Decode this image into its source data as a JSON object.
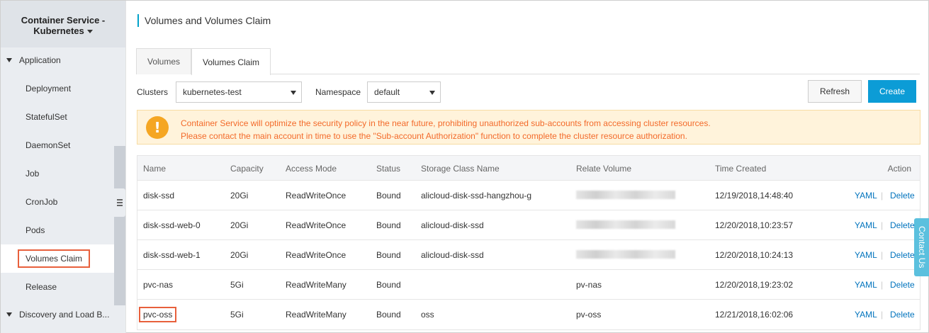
{
  "sidebar": {
    "header_line1": "Container Service -",
    "header_line2": "Kubernetes",
    "group_application": "Application",
    "items": [
      {
        "label": "Deployment"
      },
      {
        "label": "StatefulSet"
      },
      {
        "label": "DaemonSet"
      },
      {
        "label": "Job"
      },
      {
        "label": "CronJob"
      },
      {
        "label": "Pods"
      },
      {
        "label": "Volumes Claim"
      },
      {
        "label": "Release"
      }
    ],
    "group_discovery": "Discovery and Load B..."
  },
  "page_title": "Volumes and Volumes Claim",
  "tabs": [
    {
      "label": "Volumes"
    },
    {
      "label": "Volumes Claim"
    }
  ],
  "filters": {
    "clusters_label": "Clusters",
    "clusters_value": "kubernetes-test",
    "namespace_label": "Namespace",
    "namespace_value": "default"
  },
  "buttons": {
    "refresh": "Refresh",
    "create": "Create"
  },
  "alert": {
    "icon": "!",
    "line1": "Container Service will optimize the security policy in the near future, prohibiting unauthorized sub-accounts from accessing cluster resources.",
    "line2": "Please contact the main account in time to use the \"Sub-account Authorization\" function to complete the cluster resource authorization."
  },
  "table": {
    "headers": {
      "name": "Name",
      "capacity": "Capacity",
      "access_mode": "Access Mode",
      "status": "Status",
      "storage_class": "Storage Class Name",
      "relate_volume": "Relate Volume",
      "time_created": "Time Created",
      "action": "Action"
    },
    "rows": [
      {
        "name": "disk-ssd",
        "capacity": "20Gi",
        "access_mode": "ReadWriteOnce",
        "status": "Bound",
        "storage_class": "alicloud-disk-ssd-hangzhou-g",
        "relate_volume": "",
        "time_created": "12/19/2018,14:48:40"
      },
      {
        "name": "disk-ssd-web-0",
        "capacity": "20Gi",
        "access_mode": "ReadWriteOnce",
        "status": "Bound",
        "storage_class": "alicloud-disk-ssd",
        "relate_volume": "",
        "time_created": "12/20/2018,10:23:57"
      },
      {
        "name": "disk-ssd-web-1",
        "capacity": "20Gi",
        "access_mode": "ReadWriteOnce",
        "status": "Bound",
        "storage_class": "alicloud-disk-ssd",
        "relate_volume": "",
        "time_created": "12/20/2018,10:24:13"
      },
      {
        "name": "pvc-nas",
        "capacity": "5Gi",
        "access_mode": "ReadWriteMany",
        "status": "Bound",
        "storage_class": "",
        "relate_volume": "pv-nas",
        "time_created": "12/20/2018,19:23:02"
      },
      {
        "name": "pvc-oss",
        "capacity": "5Gi",
        "access_mode": "ReadWriteMany",
        "status": "Bound",
        "storage_class": "oss",
        "relate_volume": "pv-oss",
        "time_created": "12/21/2018,16:02:06"
      }
    ],
    "action_yaml": "YAML",
    "action_sep": "|",
    "action_delete": "Delete"
  },
  "contact_label": "Contact Us",
  "colors": {
    "accent": "#0c9cd6",
    "highlight": "#e8603c",
    "alert_text": "#f36a2a",
    "link": "#0073bd"
  }
}
